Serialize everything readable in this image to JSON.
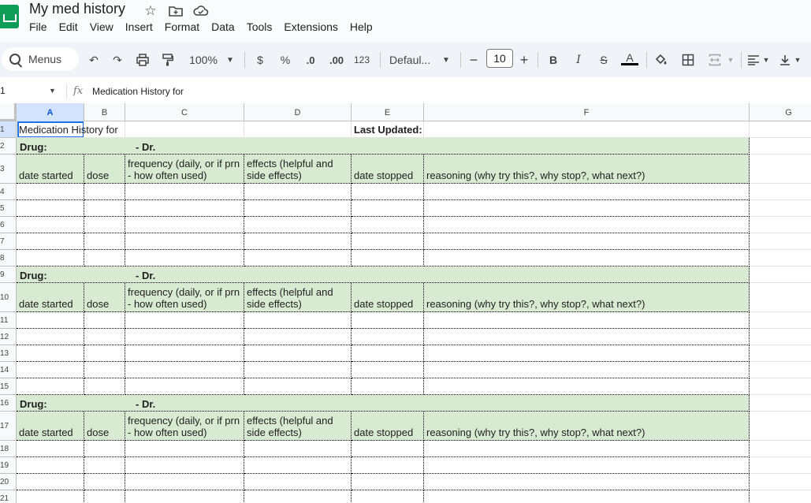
{
  "app": {
    "doc_title": "My med history",
    "menu": [
      "File",
      "Edit",
      "View",
      "Insert",
      "Format",
      "Data",
      "Tools",
      "Extensions",
      "Help"
    ]
  },
  "toolbar": {
    "menus_label": "Menus",
    "zoom": "100%",
    "currency": "$",
    "percent": "%",
    "dec_decrease": ".0",
    "dec_increase": ".00",
    "number_format": "123",
    "font": "Defaul...",
    "font_size": "10",
    "bold": "B",
    "italic": "I",
    "strike": "S",
    "text_color": "A"
  },
  "formula_bar": {
    "name_box": "1",
    "fx": "fx",
    "value": "Medication History for"
  },
  "columns": [
    "A",
    "B",
    "C",
    "D",
    "E",
    "F",
    "G"
  ],
  "sheet": {
    "row1": {
      "a": "Medication History for",
      "e": "Last Updated:"
    },
    "drug_label": "Drug:",
    "dr_label": "- Dr.",
    "headers": {
      "date_started": "date started",
      "dose": "dose",
      "frequency": "frequency (daily, or if prn - how often used)",
      "effects": "effects (helpful and side effects)",
      "date_stopped": "date stopped",
      "reasoning": "reasoning (why try this?, why stop?, what next?)"
    }
  },
  "row_numbers": [
    "1",
    "2",
    "3",
    "4",
    "5",
    "6",
    "7",
    "8",
    "9",
    "10",
    "11",
    "12",
    "13",
    "14",
    "15",
    "16",
    "17",
    "18",
    "19",
    "20",
    "21"
  ],
  "colors": {
    "section_fill": "#d9ead3",
    "selection": "#1a73e8",
    "toolbar_bg": "#f0f4f9"
  }
}
